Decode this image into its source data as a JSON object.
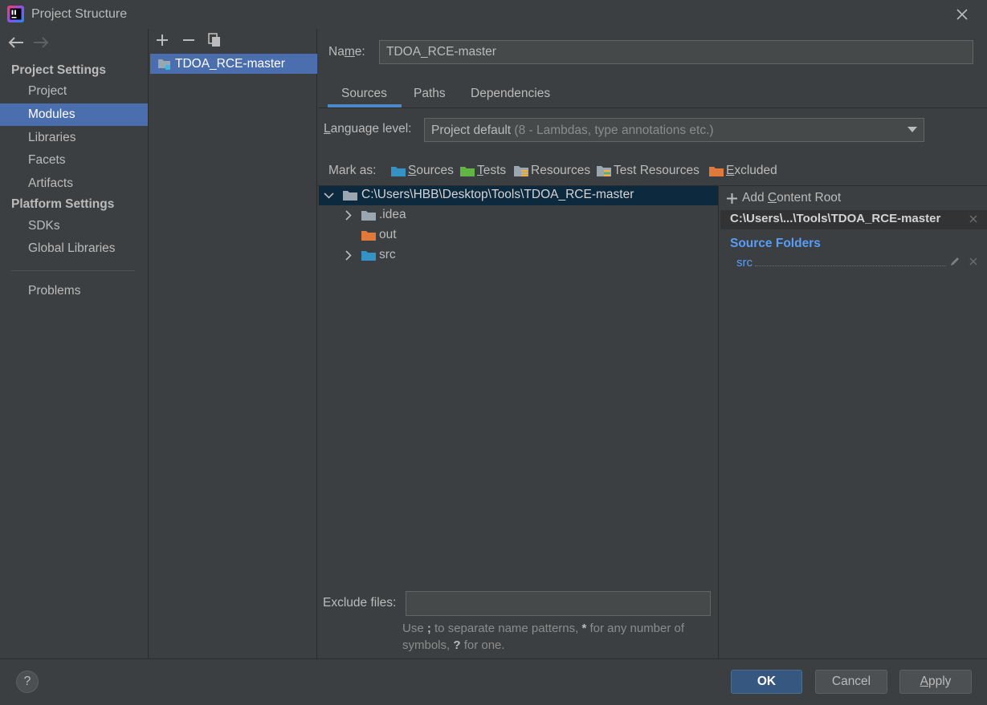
{
  "window": {
    "title": "Project Structure"
  },
  "nav": {
    "sections": [
      {
        "label": "Project Settings",
        "items": [
          "Project",
          "Modules",
          "Libraries",
          "Facets",
          "Artifacts"
        ]
      },
      {
        "label": "Platform Settings",
        "items": [
          "SDKs",
          "Global Libraries"
        ]
      }
    ],
    "problems_label": "Problems",
    "selected_item": "Modules"
  },
  "modules": {
    "items": [
      "TDOA_RCE-master"
    ]
  },
  "detail": {
    "name_label_pre": "Na",
    "name_label_u": "m",
    "name_label_post": "e:",
    "name_value": "TDOA_RCE-master",
    "tabs": [
      "Sources",
      "Paths",
      "Dependencies"
    ],
    "active_tab": "Sources",
    "language_level_u": "L",
    "language_level_rest": "anguage level:",
    "language_level_value": "Project default",
    "language_level_detail": "(8 - Lambdas, type annotations etc.)",
    "mark_as_label": "Mark as:",
    "mark_as": [
      {
        "u": "S",
        "rest": "ources",
        "color": "#3592c4",
        "icon": "sources-folder-icon"
      },
      {
        "u": "T",
        "rest": "ests",
        "color": "#62b543",
        "icon": "tests-folder-icon"
      },
      {
        "u": "",
        "rest": "Resources",
        "color": "#9aa7b0",
        "icon": "resources-folder-icon"
      },
      {
        "u": "",
        "rest": "Test Resources",
        "color": "#9aa7b0",
        "icon": "test-resources-folder-icon"
      },
      {
        "u": "E",
        "rest": "xcluded",
        "color": "#e07a3a",
        "icon": "excluded-folder-icon"
      }
    ]
  },
  "tree": {
    "root": "C:\\Users\\HBB\\Desktop\\Tools\\TDOA_RCE-master",
    "children": [
      {
        "label": ".idea",
        "expandable": true,
        "color": "#9aa7b0"
      },
      {
        "label": "out",
        "expandable": false,
        "color": "#e07a3a"
      },
      {
        "label": "src",
        "expandable": true,
        "color": "#3592c4"
      }
    ]
  },
  "roots": {
    "add_pre": "Add ",
    "add_u": "C",
    "add_post": "ontent Root",
    "root_path": "C:\\Users\\...\\Tools\\TDOA_RCE-master",
    "source_folders_title": "Source Folders",
    "source_folders": [
      "src"
    ]
  },
  "exclude": {
    "label": "Exclude files:",
    "value": "",
    "hint_a": "Use ",
    "hint_b": ";",
    "hint_c": " to separate name patterns, ",
    "hint_d": "*",
    "hint_e": " for any number of symbols, ",
    "hint_f": "?",
    "hint_g": " for one."
  },
  "buttons": {
    "help": "?",
    "ok": "OK",
    "cancel": "Cancel",
    "apply_u": "A",
    "apply_rest": "pply"
  },
  "colors": {
    "background": "#3c3f41",
    "selection": "#4b6eaf",
    "tree_selection": "#0d293e",
    "link": "#589df6",
    "primary_button": "#365880"
  }
}
